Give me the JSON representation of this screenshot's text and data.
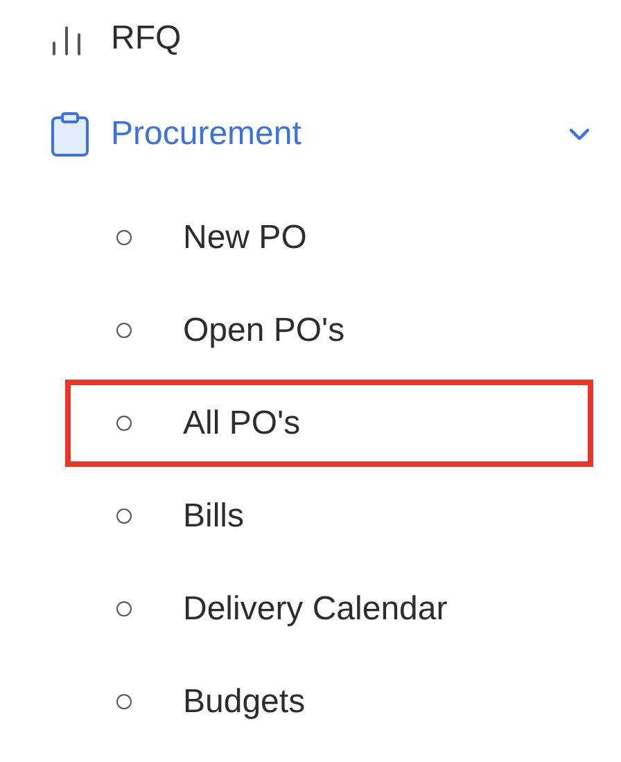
{
  "menu": [
    {
      "label": "RFQ",
      "kind": "link"
    },
    {
      "label": "Procurement",
      "kind": "group",
      "selected": true,
      "expanded": true,
      "children": [
        {
          "label": "New PO",
          "highlighted": false
        },
        {
          "label": "Open PO's",
          "highlighted": false
        },
        {
          "label": "All PO's",
          "highlighted": true
        },
        {
          "label": "Bills",
          "highlighted": false
        },
        {
          "label": "Delivery Calendar",
          "highlighted": false
        },
        {
          "label": "Budgets",
          "highlighted": false
        }
      ]
    }
  ]
}
